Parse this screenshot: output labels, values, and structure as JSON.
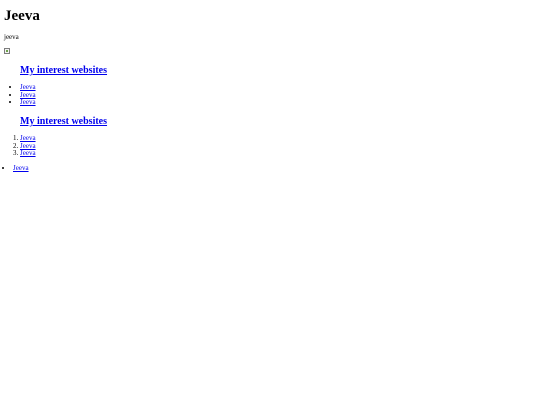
{
  "header": {
    "title": "Jeeva",
    "subtitle": "jeeva"
  },
  "main": {
    "image": {
      "icon": "broken-image-icon"
    },
    "sections": [
      {
        "heading": "My interest websites",
        "list_type": "unordered",
        "links": [
          "Jeeva",
          "Jeeva",
          "Jeeva"
        ]
      },
      {
        "heading": "My interest websites",
        "list_type": "ordered",
        "links": [
          "Jeeva",
          "Jeeva",
          "Jeeva"
        ]
      }
    ]
  },
  "footer": {
    "links": [
      "Jeeva"
    ]
  },
  "colors": {
    "link": "#0000ee",
    "text": "#000000",
    "background": "#ffffff"
  }
}
